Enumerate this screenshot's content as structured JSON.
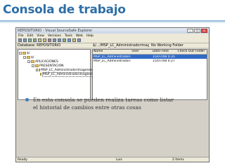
{
  "slide": {
    "title": "Consola de trabajo"
  },
  "window": {
    "title": "REPOSITORIO - Visual SourceSafe Explorer",
    "buttons": [
      "_",
      "□",
      "x"
    ],
    "menu": [
      "File",
      "Edit",
      "View",
      "Versions",
      "Tools",
      "Web",
      "Help"
    ],
    "database_label": "Database: REPOSITORIO",
    "path_label": "$/.../MSP_LC_Administradorimagenes",
    "working_folder": "No Working Folder",
    "tree": [
      {
        "indent": 0,
        "label": "$/"
      },
      {
        "indent": 1,
        "label": "$/"
      },
      {
        "indent": 2,
        "label": "APLICACIONES"
      },
      {
        "indent": 3,
        "label": "PRESENTACION"
      },
      {
        "indent": 4,
        "label": "MSP_LC_Administradorimagenes.Wan"
      },
      {
        "indent": 5,
        "label": "MSP_LC_Administradorimagenes"
      }
    ],
    "list": {
      "headers": [
        "Name",
        "User",
        "Date-Time",
        "Check Out Folder"
      ],
      "rows": [
        [
          "MSP_LC_Administradorimag",
          "",
          "15/07/08   0:35",
          ""
        ],
        [
          "MSP_LC_Administradorimag",
          "",
          "15/07/08   0:27",
          ""
        ]
      ]
    },
    "status": {
      "ready": "Ready",
      "user": "Luis",
      "items": "2 Items"
    }
  },
  "bullet": "En esta consola se pueden realiza tareas como listar el historial de cambios entre otras cosas"
}
